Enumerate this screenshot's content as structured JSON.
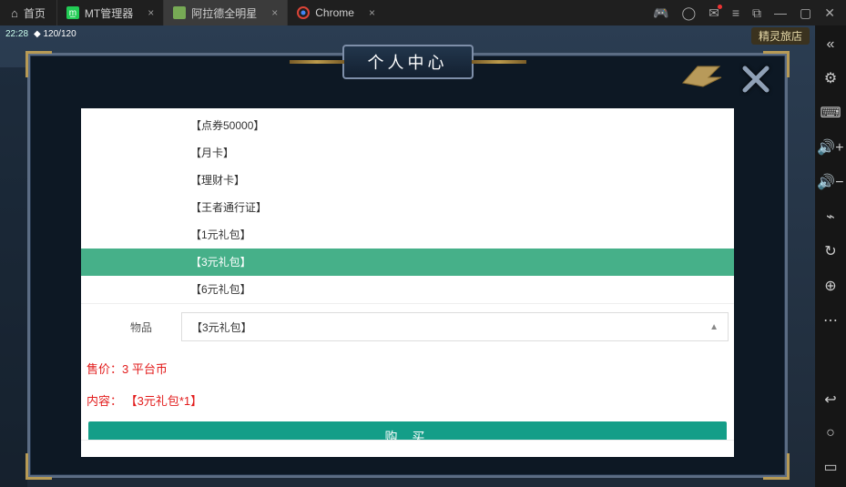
{
  "topbar": {
    "home": "首页",
    "tabs": [
      {
        "label": "MT管理器",
        "icon_bg": "#3a5",
        "icon_txt": "MT"
      },
      {
        "label": "阿拉德全明星",
        "icon_bg": "#6b4",
        "icon_txt": ""
      },
      {
        "label": "Chrome",
        "icon_bg": "transparent",
        "icon_txt": ""
      }
    ]
  },
  "game": {
    "time": "22:28",
    "hp": "120/120",
    "shop": "精灵旅店"
  },
  "modal": {
    "title": "个人中心"
  },
  "dropdown": {
    "options": [
      "【点券50000】",
      "【月卡】",
      "【理财卡】",
      "【王者通行证】",
      "【1元礼包】",
      "【3元礼包】",
      "【6元礼包】"
    ],
    "selected_index": 5
  },
  "select": {
    "label": "物品",
    "value": "【3元礼包】"
  },
  "details": {
    "price_label": "售价：",
    "price_value": "3 平台币",
    "content_label": "内容：",
    "content_value": "【3元礼包*1】",
    "buy": "购 买"
  }
}
